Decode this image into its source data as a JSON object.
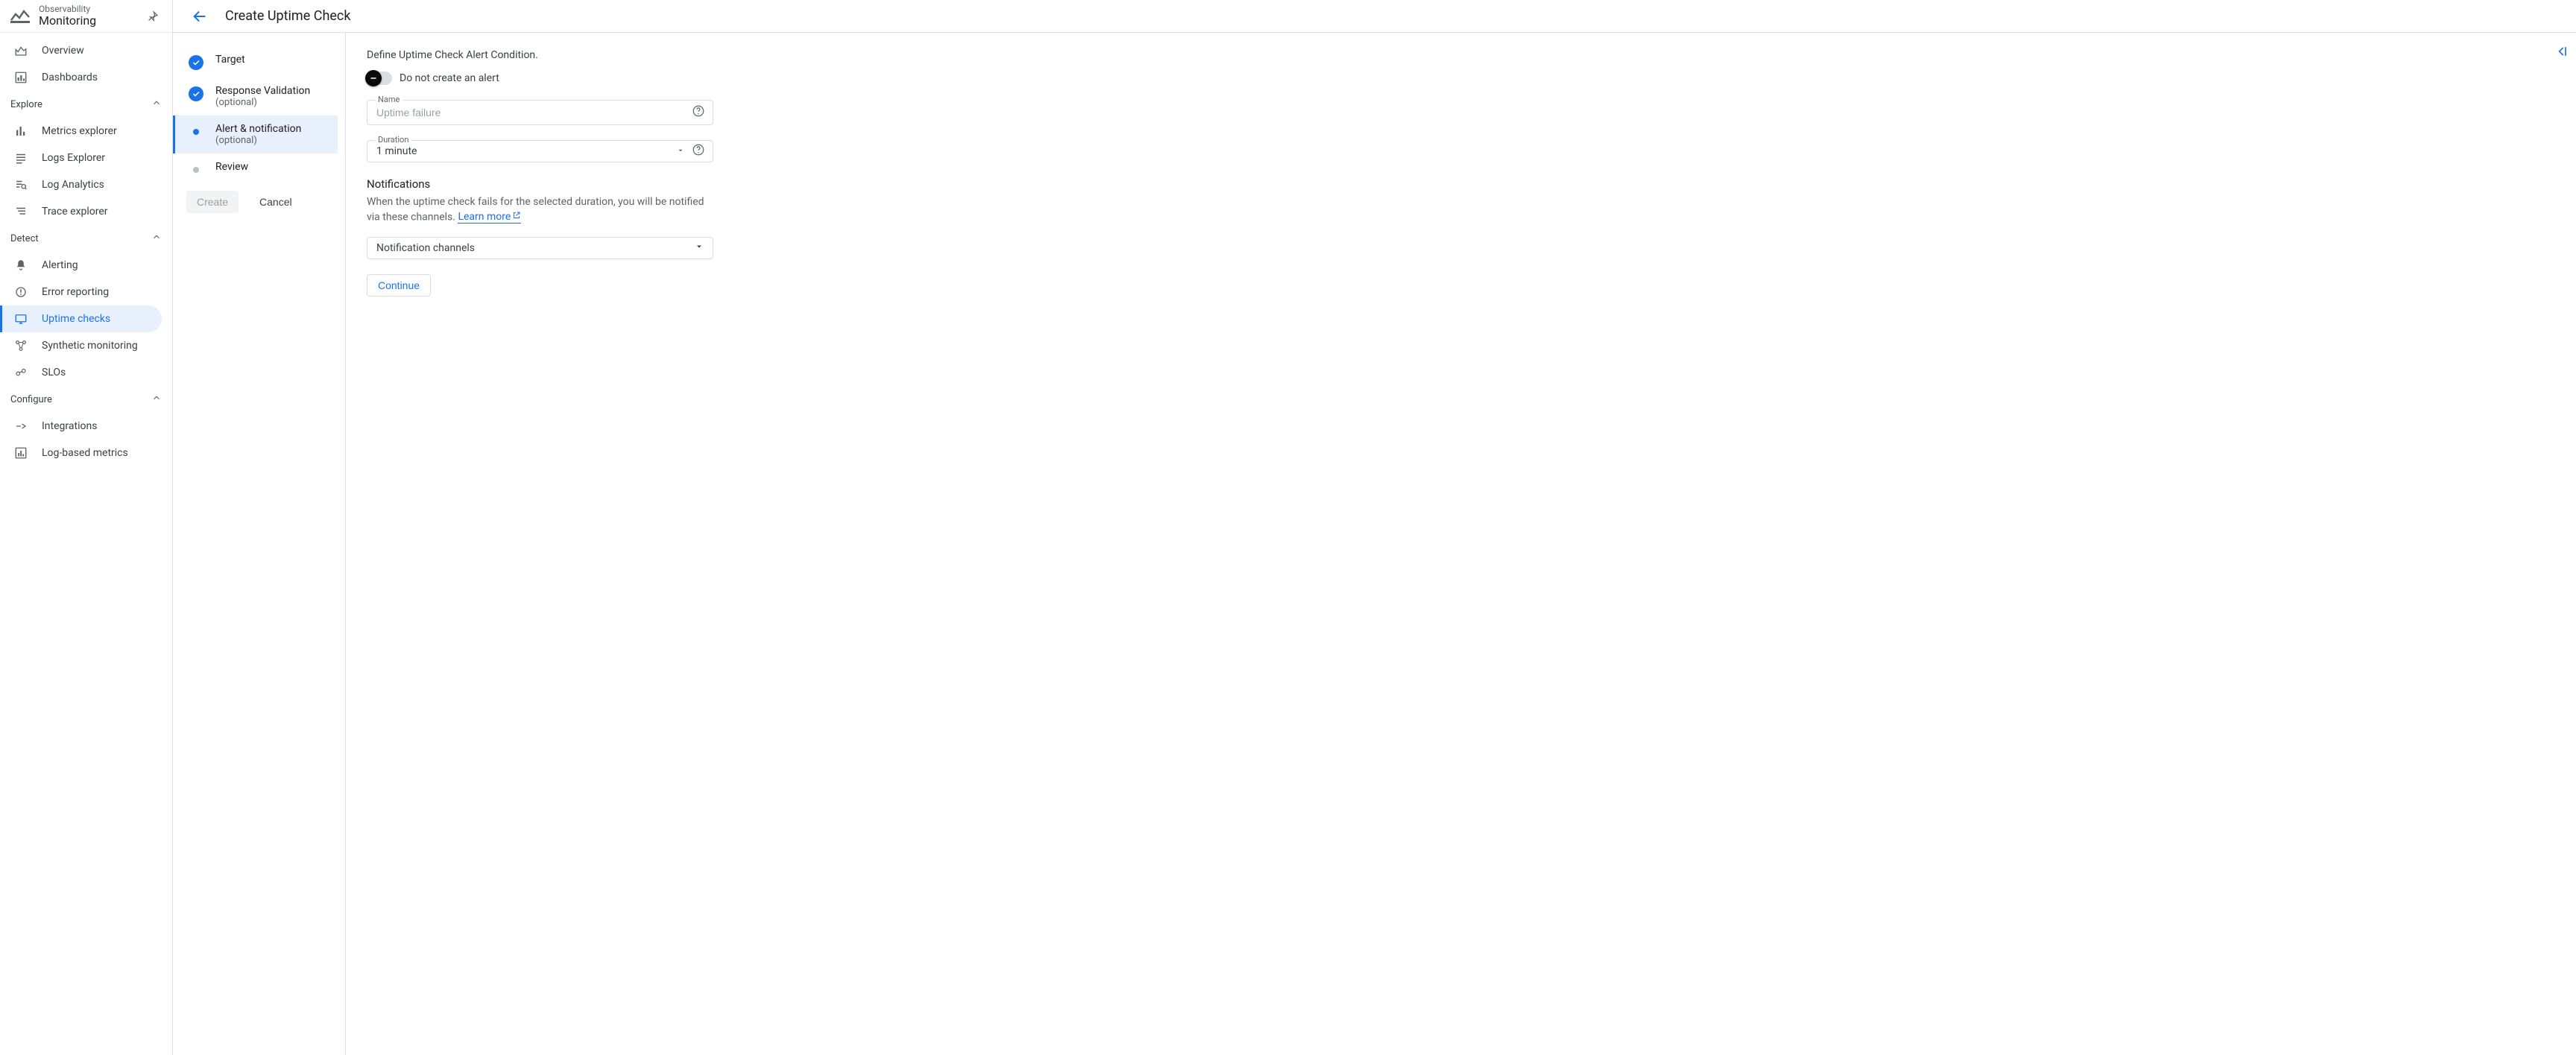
{
  "product": {
    "sup": "Observability",
    "main": "Monitoring"
  },
  "nav": {
    "top": [
      {
        "label": "Overview"
      },
      {
        "label": "Dashboards"
      }
    ],
    "explore": {
      "title": "Explore",
      "items": [
        {
          "label": "Metrics explorer"
        },
        {
          "label": "Logs Explorer"
        },
        {
          "label": "Log Analytics"
        },
        {
          "label": "Trace explorer"
        }
      ]
    },
    "detect": {
      "title": "Detect",
      "items": [
        {
          "label": "Alerting"
        },
        {
          "label": "Error reporting"
        },
        {
          "label": "Uptime checks"
        },
        {
          "label": "Synthetic monitoring"
        },
        {
          "label": "SLOs"
        }
      ]
    },
    "configure": {
      "title": "Configure",
      "items": [
        {
          "label": "Integrations"
        },
        {
          "label": "Log-based metrics"
        }
      ]
    }
  },
  "page": {
    "title": "Create Uptime Check"
  },
  "steps": {
    "target": {
      "label": "Target"
    },
    "respval": {
      "label": "Response Validation",
      "sub": "(optional)"
    },
    "alert": {
      "label": "Alert & notification",
      "sub": "(optional)"
    },
    "review": {
      "label": "Review"
    },
    "create_btn": "Create",
    "cancel_btn": "Cancel"
  },
  "form": {
    "title": "Define Uptime Check Alert Condition.",
    "toggle_label": "Do not create an alert",
    "name_label": "Name",
    "name_placeholder": "Uptime failure",
    "duration_label": "Duration",
    "duration_value": "1 minute",
    "notifications_head": "Notifications",
    "notifications_desc": "When the uptime check fails for the selected duration, you will be notified via these channels. ",
    "learn_more": "Learn more",
    "channels_placeholder": "Notification channels",
    "continue": "Continue"
  }
}
